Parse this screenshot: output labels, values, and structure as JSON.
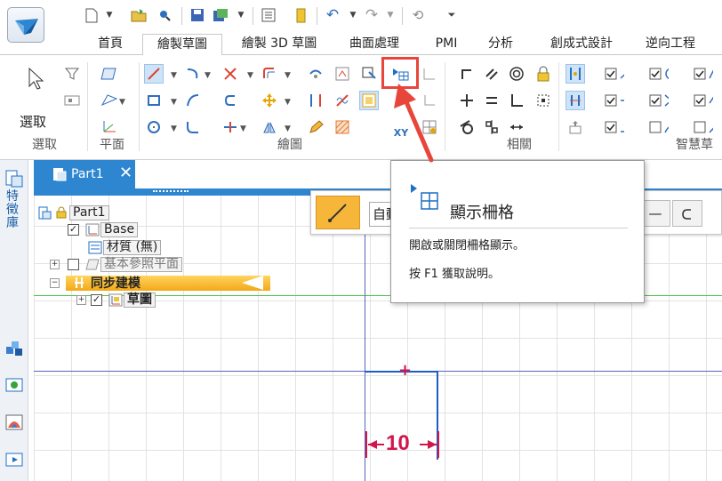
{
  "tabs": [
    "首頁",
    "繪製草圖",
    "繪製 3D 草圖",
    "曲面處理",
    "PMI",
    "分析",
    "創成式設計",
    "逆向工程"
  ],
  "active_tab_index": 1,
  "ribbon": {
    "select_label": "選取",
    "groups": {
      "select": "選取",
      "plane": "平面",
      "draw": "繪圖",
      "relate": "相關",
      "smart": "智慧草"
    },
    "xy_label": "XY"
  },
  "document": {
    "tab_title": "Part1",
    "close_glyph": "✕"
  },
  "sidebar": {
    "feature_library": "特徵庫"
  },
  "tree": {
    "root": "Part1",
    "base": "Base",
    "material": "材質 (無)",
    "ref_planes": "基本參照平面",
    "sync": "同步建模",
    "sketch": "草圖"
  },
  "command_bar": {
    "input_text": "自動"
  },
  "tooltip": {
    "title": "顯示柵格",
    "description": "開啟或關閉柵格顯示。",
    "help": "按 F1 獲取說明。"
  },
  "canvas": {
    "dimension": "10"
  },
  "colors": {
    "accent": "#2f86d0",
    "highlight": "#e8463b",
    "dimension": "#d0174d",
    "sync_bar": "#f3a817"
  }
}
